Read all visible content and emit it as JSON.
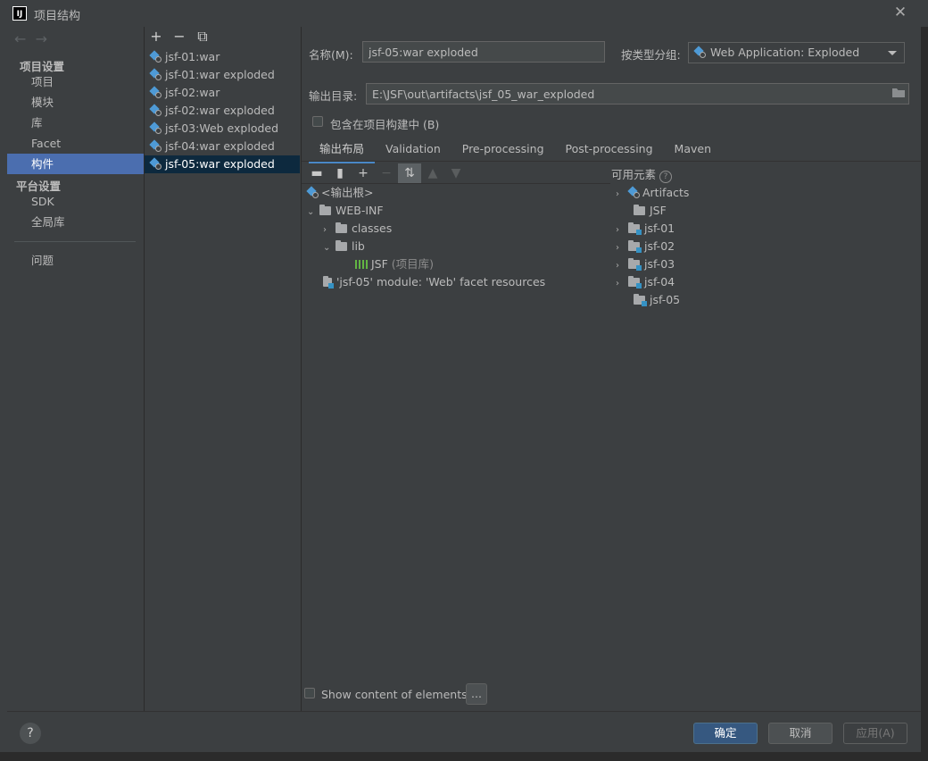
{
  "window": {
    "title": "项目结构",
    "app_icon": "IJ"
  },
  "nav": {
    "sections": [
      {
        "title": "项目设置",
        "items": [
          "项目",
          "模块",
          "库",
          "Facet",
          "构件"
        ]
      },
      {
        "title": "平台设置",
        "items": [
          "SDK",
          "全局库"
        ]
      }
    ],
    "extra": "问题",
    "selected": "构件"
  },
  "artifacts": [
    "jsf-01:war",
    "jsf-01:war exploded",
    "jsf-02:war",
    "jsf-02:war exploded",
    "jsf-03:Web exploded",
    "jsf-04:war exploded",
    "jsf-05:war exploded"
  ],
  "form": {
    "name_label": "名称(M):",
    "name_value": "jsf-05:war exploded",
    "type_label": "按类型分组:",
    "type_value": "Web Application: Exploded",
    "output_label": "输出目录:",
    "output_value": "E:\\JSF\\out\\artifacts\\jsf_05_war_exploded",
    "include_label": "包含在项目构建中 (B)"
  },
  "tabs": [
    "输出布局",
    "Validation",
    "Pre-processing",
    "Post-processing",
    "Maven"
  ],
  "layout_tree": {
    "root": "<输出根>",
    "webinf": "WEB-INF",
    "classes": "classes",
    "lib": "lib",
    "jsf_lib": "JSF",
    "jsf_lib_suffix": "(项目库)",
    "facet": "'jsf-05' module: 'Web' facet resources"
  },
  "available": {
    "label": "可用元素",
    "items": [
      "Artifacts",
      "JSF",
      "jsf-01",
      "jsf-02",
      "jsf-03",
      "jsf-04",
      "jsf-05"
    ]
  },
  "bottom": {
    "show_content": "Show content of elements",
    "ellipsis": "...",
    "help": "?",
    "ok": "确定",
    "cancel": "取消",
    "apply": "应用(A)"
  },
  "colors": {
    "accent": "#4b6eaf",
    "selection": "#0d293e",
    "primary_button": "#365880"
  }
}
